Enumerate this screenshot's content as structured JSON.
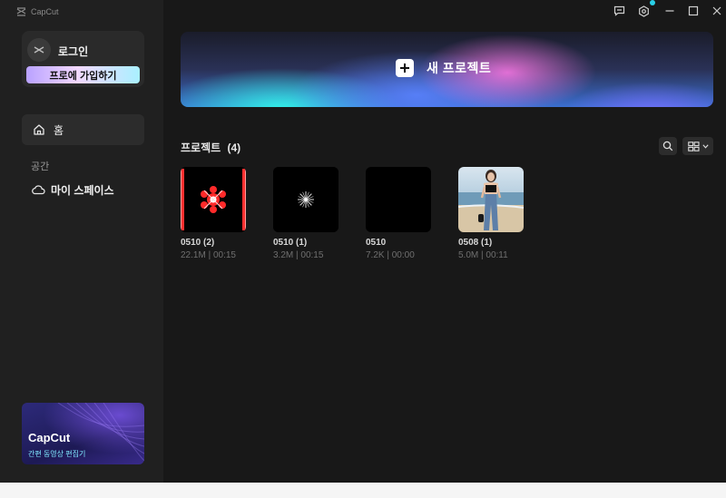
{
  "app": {
    "name": "CapCut"
  },
  "sidebar": {
    "login_label": "로그인",
    "signup_label": "프로에 가입하기",
    "nav_home": {
      "label": "홈",
      "icon": "home-icon"
    },
    "section_label": "공간",
    "nav_space": {
      "label": "마이 스페이스",
      "icon": "cloud-icon"
    },
    "promo": {
      "title": "CapCut",
      "subtitle": "간편 동영상 편집기"
    }
  },
  "titlebar": {
    "icons": [
      "feedback-icon",
      "settings-icon",
      "minimize-icon",
      "maximize-icon",
      "close-icon"
    ],
    "notification_color": "#29d0e8"
  },
  "main": {
    "new_project_label": "새 프로젝트",
    "projects_title": "프로젝트",
    "projects_count": "(4)",
    "projects": [
      {
        "name": "0510 (2)",
        "size": "22.1M",
        "duration": "00:15",
        "thumb": "red-framed-flower"
      },
      {
        "name": "0510 (1)",
        "size": "3.2M",
        "duration": "00:15",
        "thumb": "white-starburst"
      },
      {
        "name": "0510",
        "size": "7.2K",
        "duration": "00:00",
        "thumb": "black"
      },
      {
        "name": "0508 (1)",
        "size": "5.0M",
        "duration": "00:11",
        "thumb": "beach-photo"
      }
    ],
    "meta_separator": " | "
  },
  "colors": {
    "background": "#181818",
    "sidebar": "#202020",
    "accent": "#29d0e8"
  }
}
